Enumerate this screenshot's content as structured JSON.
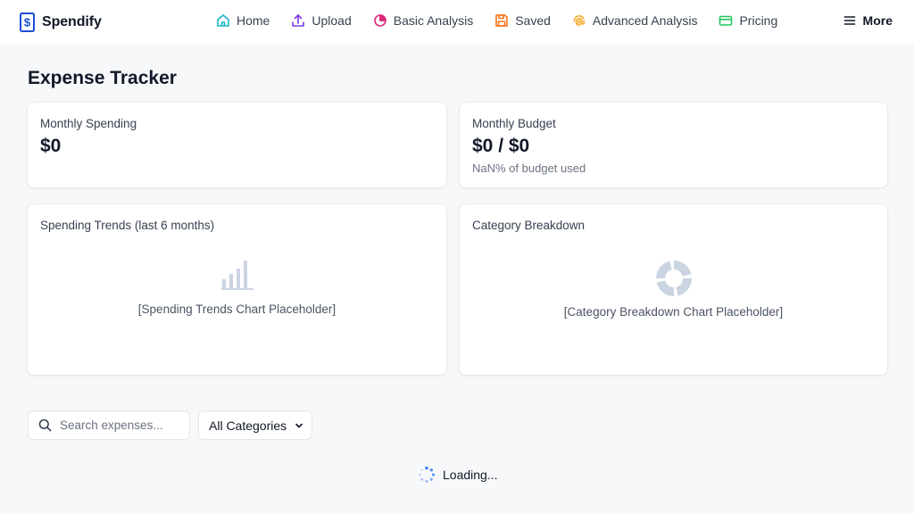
{
  "brand": {
    "name": "Spendify",
    "icon": "dollar-document-icon"
  },
  "nav": {
    "items": [
      {
        "label": "Home",
        "icon": "home-icon"
      },
      {
        "label": "Upload",
        "icon": "upload-icon"
      },
      {
        "label": "Basic Analysis",
        "icon": "pie-chart-icon"
      },
      {
        "label": "Saved",
        "icon": "save-icon"
      },
      {
        "label": "Advanced Analysis",
        "icon": "fingerprint-icon"
      },
      {
        "label": "Pricing",
        "icon": "credit-card-icon"
      }
    ],
    "more_label": "More"
  },
  "page": {
    "title": "Expense Tracker"
  },
  "summary": {
    "monthly_spending": {
      "label": "Monthly Spending",
      "value": "$0"
    },
    "monthly_budget": {
      "label": "Monthly Budget",
      "value": "$0 / $0",
      "sub": "NaN% of budget used"
    }
  },
  "charts": {
    "trends": {
      "title": "Spending Trends (last 6 months)",
      "placeholder": "[Spending Trends Chart Placeholder]"
    },
    "breakdown": {
      "title": "Category Breakdown",
      "placeholder": "[Category Breakdown Chart Placeholder]"
    }
  },
  "filters": {
    "search_placeholder": "Search expenses...",
    "category_selected": "All Categories"
  },
  "status": {
    "loading": "Loading..."
  },
  "colors": {
    "home": "#14b8c7",
    "upload": "#7c3aed",
    "analysis": "#db2777",
    "saved": "#f97316",
    "advanced": "#f59e0b",
    "pricing": "#22c55e",
    "brand": "#2563eb",
    "spinner": "#3b82f6"
  }
}
